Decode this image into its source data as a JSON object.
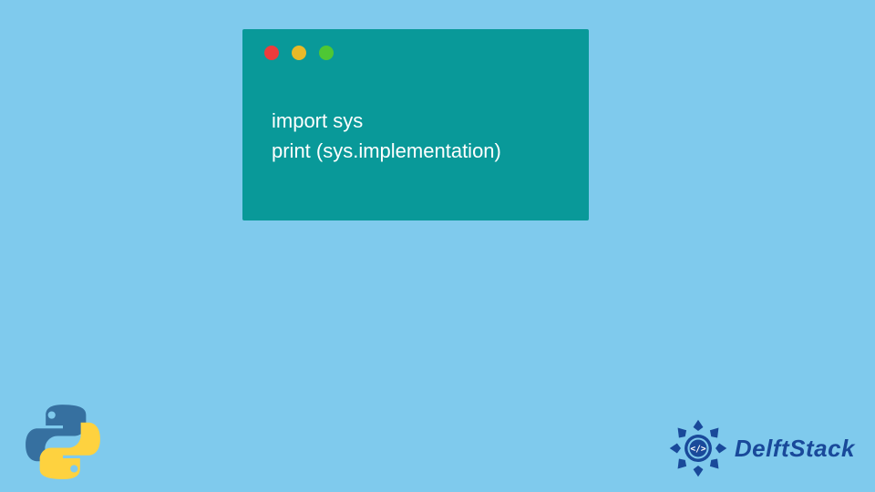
{
  "code": {
    "line1": "import sys",
    "line2": "print (sys.implementation)"
  },
  "logos": {
    "python": "python-logo",
    "brand_text": "DelftStack"
  },
  "colors": {
    "bg": "#7fcaed",
    "window": "#099999",
    "dot_red": "#ed3c3c",
    "dot_yellow": "#e9b928",
    "dot_green": "#4ec734",
    "brand_blue": "#19499a"
  }
}
